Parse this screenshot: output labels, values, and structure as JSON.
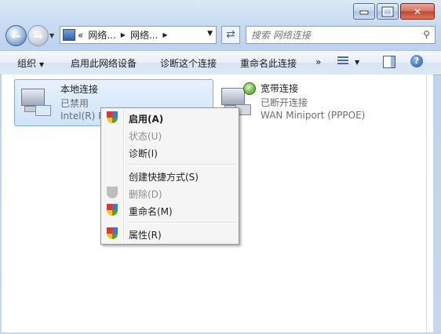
{
  "window": {
    "caption_buttons": [
      "minimize",
      "maximize",
      "close"
    ]
  },
  "address": {
    "prefix": "«",
    "crumbs": [
      "网络...",
      "网络..."
    ],
    "search_placeholder": "搜索 网络连接"
  },
  "toolbar": {
    "organize": "组织",
    "enable": "启用此网络设备",
    "diagnose": "诊断这个连接",
    "rename": "重命名此连接",
    "more": "»"
  },
  "connections": [
    {
      "name": "本地连接",
      "status": "已禁用",
      "device": "Intel(R) P"
    },
    {
      "name": "宽带连接",
      "status": "已断开连接",
      "device": "WAN Miniport (PPPOE)"
    }
  ],
  "context_menu": {
    "items": [
      {
        "label": "启用(A)",
        "bold": true,
        "disabled": false,
        "icon": "uac-shield-icon"
      },
      {
        "label": "状态(U)",
        "bold": false,
        "disabled": true,
        "icon": ""
      },
      {
        "label": "诊断(I)",
        "bold": false,
        "disabled": false,
        "icon": ""
      },
      {
        "label": "创建快捷方式(S)",
        "bold": false,
        "disabled": false,
        "icon": ""
      },
      {
        "label": "删除(D)",
        "bold": false,
        "disabled": true,
        "icon": "uac-shield-icon"
      },
      {
        "label": "重命名(M)",
        "bold": false,
        "disabled": false,
        "icon": "uac-shield-icon"
      },
      {
        "label": "属性(R)",
        "bold": false,
        "disabled": false,
        "icon": "uac-shield-icon"
      }
    ]
  }
}
